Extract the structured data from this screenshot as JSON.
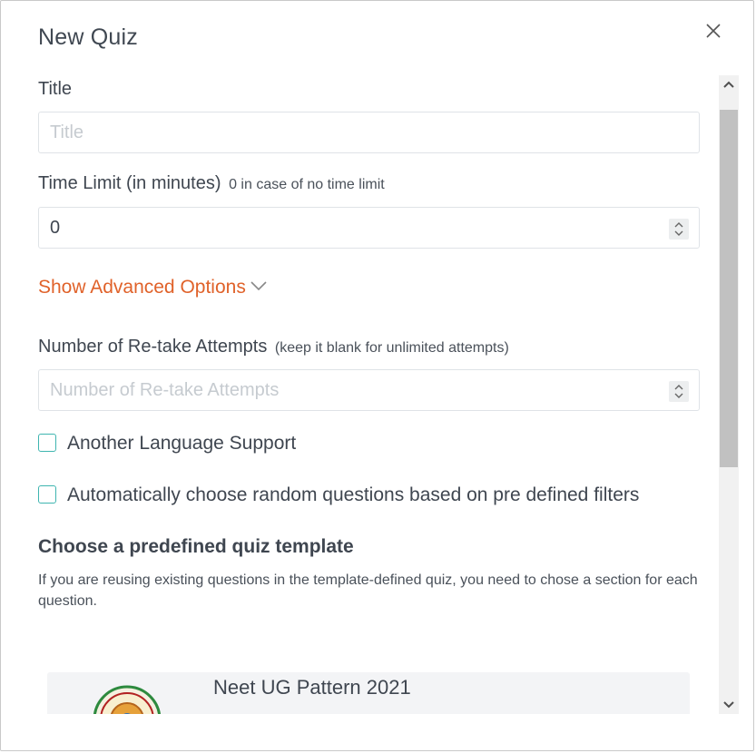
{
  "modal": {
    "title": "New Quiz",
    "close_icon": "close-icon"
  },
  "form": {
    "title_label": "Title",
    "title_placeholder": "Title",
    "time_limit_label": "Time Limit (in minutes)",
    "time_limit_hint": "0 in case of no time limit",
    "time_limit_value": "0",
    "advanced_options_label": "Show Advanced Options",
    "retake_label": "Number of Re-take Attempts",
    "retake_hint": "(keep it blank for unlimited attempts)",
    "retake_placeholder": "Number of Re-take Attempts",
    "another_language_label": "Another Language Support",
    "another_language_checked": false,
    "random_questions_label": "Automatically choose random questions based on pre defined filters",
    "random_questions_checked": false
  },
  "templates": {
    "heading": "Choose a predefined quiz template",
    "description": "If you are reusing existing questions in the template-defined quiz, you need to chose a section for each question.",
    "items": [
      {
        "name": "Neet UG Pattern 2021",
        "icon": "seal-logo"
      }
    ]
  },
  "colors": {
    "accent_orange": "#e0622a",
    "checkbox_border": "#3fb5b0",
    "text": "#3f4650"
  }
}
